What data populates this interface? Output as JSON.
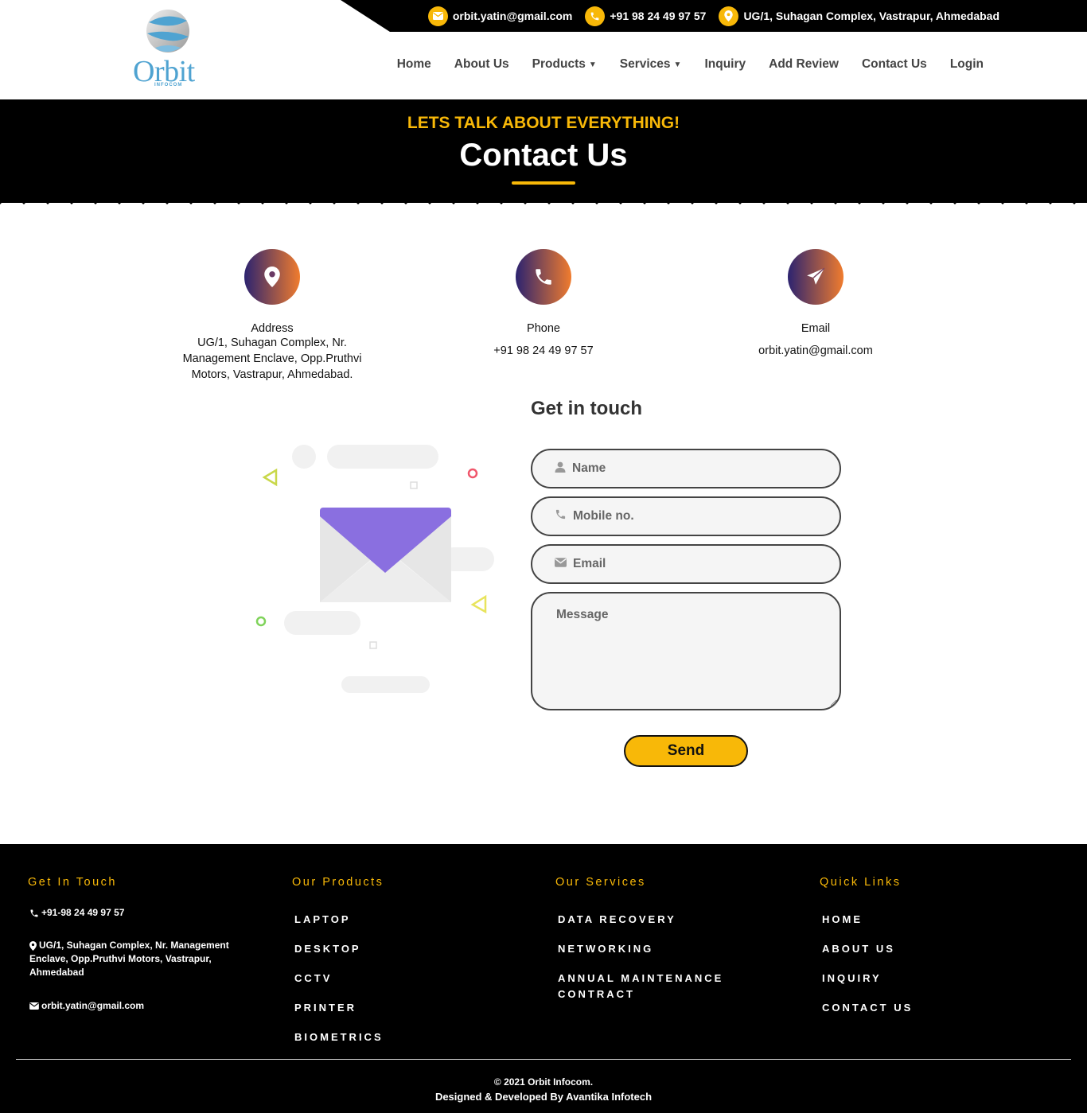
{
  "topbar": {
    "email": "orbit.yatin@gmail.com",
    "phone": "+91 98 24 49 97 57",
    "address": "UG/1, Suhagan Complex, Vastrapur, Ahmedabad"
  },
  "logo": {
    "name": "Orbit",
    "sub": "INFOCOM"
  },
  "nav": {
    "home": "Home",
    "about": "About Us",
    "products": "Products",
    "services": "Services",
    "inquiry": "Inquiry",
    "review": "Add Review",
    "contact": "Contact Us",
    "login": "Login"
  },
  "hero": {
    "kicker": "LETS TALK ABOUT EVERYTHING!",
    "title": "Contact Us"
  },
  "cards": {
    "address": {
      "label": "Address",
      "lines": [
        "UG/1, Suhagan Complex, Nr.",
        "Management Enclave, Opp.Pruthvi",
        "Motors, Vastrapur, Ahmedabad."
      ]
    },
    "phone": {
      "label": "Phone",
      "value": "+91 98 24 49 97 57"
    },
    "email": {
      "label": "Email",
      "value": "orbit.yatin@gmail.com"
    }
  },
  "form": {
    "heading": "Get in touch",
    "name_placeholder": "Name",
    "mobile_placeholder": "Mobile no.",
    "email_placeholder": "Email",
    "message_placeholder": "Message",
    "send_label": "Send"
  },
  "footer": {
    "get_in_touch": {
      "title": "Get In Touch",
      "phone": "+91-98 24 49 97 57",
      "address_lines": [
        "UG/1, Suhagan Complex, Nr. Management",
        "Enclave, Opp.Pruthvi Motors, Vastrapur,",
        "Ahmedabad"
      ],
      "email": "orbit.yatin@gmail.com"
    },
    "products": {
      "title": "Our Products",
      "items": [
        "LAPTOP",
        "DESKTOP",
        "CCTV",
        "PRINTER",
        "BIOMETRICS"
      ]
    },
    "services": {
      "title": "Our Services",
      "items": [
        "DATA RECOVERY",
        "NETWORKING",
        "ANNUAL MAINTENANCE",
        "CONTRACT"
      ]
    },
    "links": {
      "title": "Quick Links",
      "items": [
        "HOME",
        "ABOUT US",
        "INQUIRY",
        "CONTACT US"
      ]
    },
    "copyright": "© 2021 Orbit Infocom.",
    "credit": "Designed & Developed By Avantika Infotech"
  },
  "colors": {
    "accent": "#f8b808",
    "gradient_start": "#2c2370",
    "gradient_end": "#f07c2e",
    "envelope": "#8a6fe0"
  }
}
